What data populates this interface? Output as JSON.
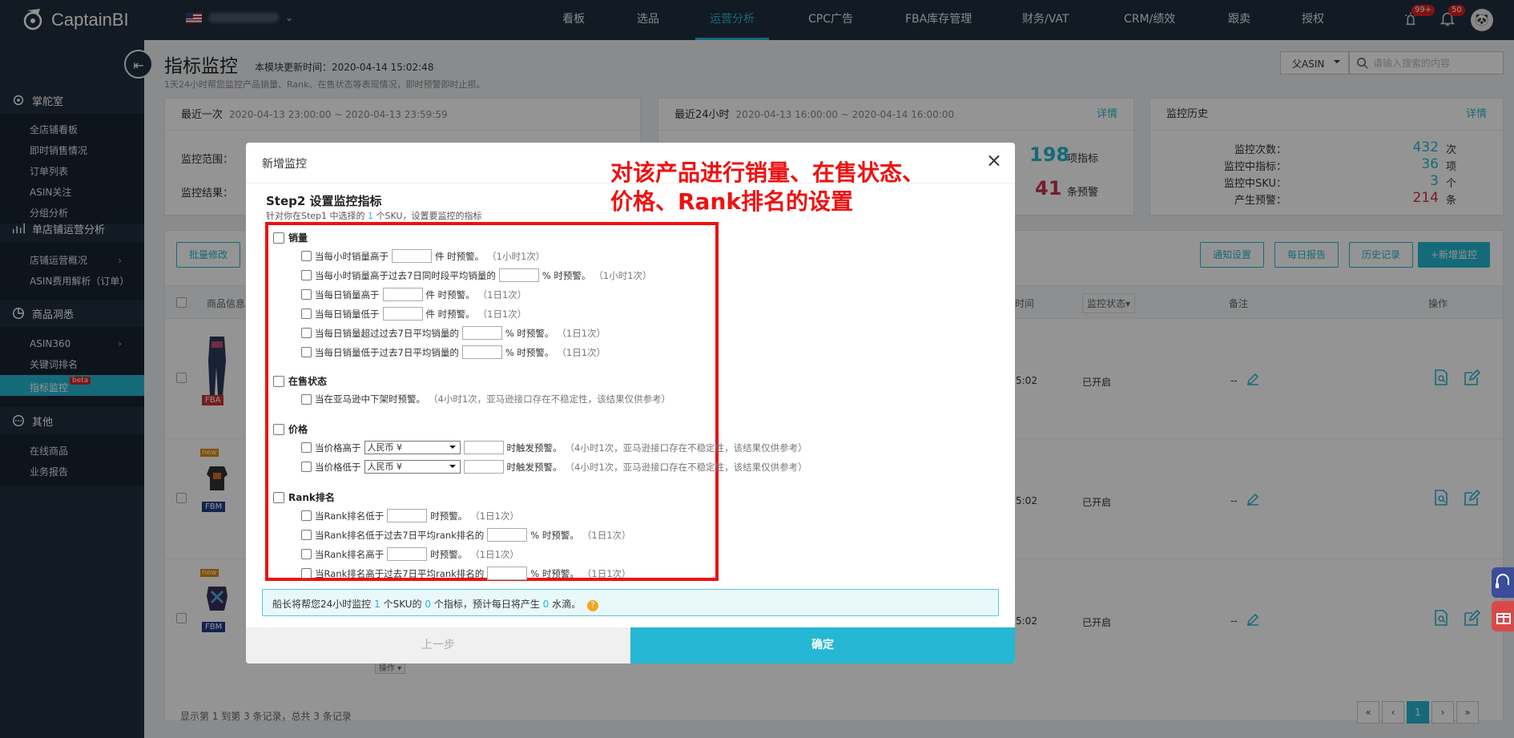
{
  "app": {
    "brand": "CaptainBI"
  },
  "nav": [
    "看板",
    "选品",
    "运营分析",
    "CPC广告",
    "FBA库存管理",
    "财务/VAT",
    "CRM/绩效",
    "跟卖",
    "授权"
  ],
  "nav_active": 2,
  "badges": {
    "alerts": "99+",
    "bell": "50"
  },
  "colors": {
    "accent": "#25b7d3",
    "sidebar": "#1f2d3d",
    "annotation": "#ee1111"
  },
  "sidebar": {
    "sec1": "掌舵室",
    "sec1_items": [
      "全店铺看板",
      "即时销售情况",
      "订单列表",
      "ASIN关注",
      "分组分析"
    ],
    "sec2": "单店铺运营分析",
    "sec2_items": [
      "店铺运营概况",
      "ASIN费用解析（订单）"
    ],
    "sec3": "商品洞悉",
    "sec3_items": [
      "ASIN360",
      "关键词排名",
      "指标监控"
    ],
    "beta": "beta",
    "sec4": "其他",
    "sec4_items": [
      "在线商品",
      "业务报告"
    ]
  },
  "page": {
    "title": "指标监控",
    "updated": "本模块更新时间：2020-04-14 15:02:48",
    "desc": "1天24小时帮您监控产品销量、Rank、在售状态等表现情况，即时预警即时止损。",
    "asin_select": "父ASIN",
    "search_placeholder": "请输入搜索的内容"
  },
  "cards": {
    "last": {
      "title": "最近一次",
      "range": "2020-04-13 23:00:00 ~ 2020-04-13 23:59:59",
      "scope": "监控范围：",
      "result": "监控结果："
    },
    "last24": {
      "title": "最近24小时",
      "range": "2020-04-13 16:00:00 ~ 2020-04-14 16:00:00",
      "detail": "详情",
      "n1": "198",
      "n1_unit": "项指标",
      "n2": "41",
      "n2_unit": "条预警"
    },
    "history": {
      "title": "监控历史",
      "detail": "详情",
      "rows": [
        {
          "label": "监控次数：",
          "value": "432",
          "unit": "次"
        },
        {
          "label": "监控中指标：",
          "value": "36",
          "unit": "项"
        },
        {
          "label": "监控中SKU：",
          "value": "3",
          "unit": "个"
        },
        {
          "label": "产生预警：",
          "value": "214",
          "unit": "条"
        }
      ]
    }
  },
  "table": {
    "batch": "批量修改",
    "buttons": [
      "通知设置",
      "每日报告",
      "历史记录",
      "+新增监控"
    ],
    "headers": {
      "product": "商品信息",
      "time": "时间",
      "status": "监控状态▾",
      "remark": "备注",
      "action": "操作"
    },
    "rows": [
      {
        "tag": "FBA",
        "is_new": false,
        "time": "5:02",
        "status": "已开启",
        "remark": "--"
      },
      {
        "tag": "FBM",
        "is_new": true,
        "time": "5:02",
        "status": "已开启",
        "remark": "--"
      },
      {
        "tag": "FBM",
        "is_new": true,
        "time": "5:02",
        "status": "已开启",
        "remark": "--"
      }
    ],
    "new_label": "new",
    "stray": "操作 ▾",
    "showing": "显示第 1 到第 3 条记录，总共 3 条记录",
    "pager": [
      "«",
      "‹",
      "1",
      "›",
      "»"
    ]
  },
  "modal": {
    "title": "新增监控",
    "close": "×",
    "step": "Step2 设置监控指标",
    "step_desc_pre": "针对你在Step1 中选择的",
    "step_desc_num": "1",
    "step_desc_post": "个SKU，设置要监控的指标",
    "groups": [
      {
        "label": "销量",
        "options": [
          [
            "当每小时销量高于",
            "件 时预警。",
            "（1小时1次）"
          ],
          [
            "当每小时销量高于过去7日同时段平均销量的",
            "% 时预警。",
            "（1小时1次）"
          ],
          [
            "当每日销量高于",
            "件 时预警。",
            "（1日1次）"
          ],
          [
            "当每日销量低于",
            "件 时预警。",
            "（1日1次）"
          ],
          [
            "当每日销量超过过去7日平均销量的",
            "% 时预警。",
            "（1日1次）"
          ],
          [
            "当每日销量低于过去7日平均销量的",
            "% 时预警。",
            "（1日1次）"
          ]
        ]
      },
      {
        "label": "在售状态",
        "options": [
          [
            "当在亚马逊中下架时预警。",
            "（4小时1次，亚马逊接口存在不稳定性，该结果仅供参考）"
          ]
        ]
      },
      {
        "label": "价格",
        "options": [
          [
            "当价格高于",
            "人民币 ¥",
            "时触发预警。",
            "（4小时1次，亚马逊接口存在不稳定性，该结果仅供参考）"
          ],
          [
            "当价格低于",
            "人民币 ¥",
            "时触发预警。",
            "（4小时1次，亚马逊接口存在不稳定性，该结果仅供参考）"
          ]
        ]
      },
      {
        "label": "Rank排名",
        "options": [
          [
            "当Rank排名低于",
            "时预警。",
            "（1日1次）"
          ],
          [
            "当Rank排名低于过去7日平均rank排名的",
            "% 时预警。",
            "（1日1次）"
          ],
          [
            "当Rank排名高于",
            "时预警。",
            "（1日1次）"
          ],
          [
            "当Rank排名高于过去7日平均rank排名的",
            "% 时预警。",
            "（1日1次）"
          ]
        ]
      }
    ],
    "info": {
      "pre": "船长将帮您24小时监控",
      "sku": "1",
      "mid": "个SKU的",
      "count": "0",
      "post1": "个指标，预计每日将产生",
      "water": "0",
      "post2": "水滴。",
      "help": "?"
    },
    "prev": "上一步",
    "ok": "确定"
  },
  "annotation": {
    "line1": "对该产品进行销量、在售状态、",
    "line2": "价格、Rank排名的设置"
  }
}
